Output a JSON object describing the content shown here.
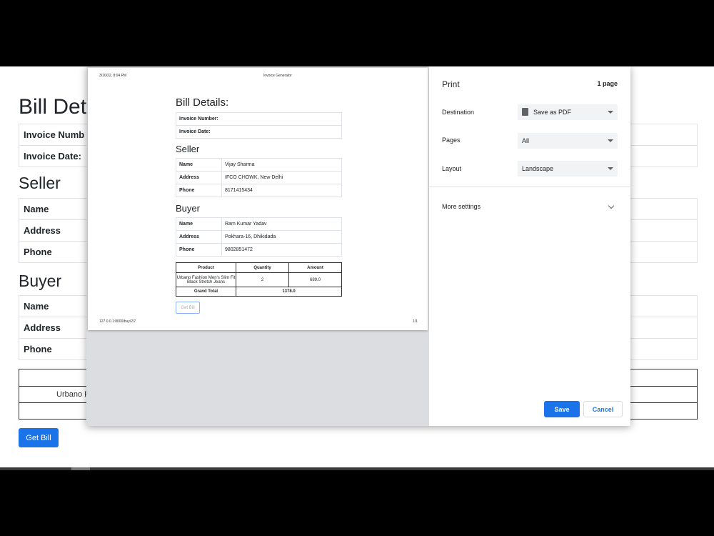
{
  "background": {
    "bill_heading": "Bill Det",
    "invoice_number_label": "Invoice Numb",
    "invoice_date_label": "Invoice Date:",
    "seller_heading": "Seller",
    "buyer_heading": "Buyer",
    "name_label": "Name",
    "address_label": "Address",
    "phone_label": "Phone",
    "product_partial": "Urbano F",
    "get_bill_button": "Get Bill"
  },
  "preview": {
    "header_date": "3/10/22, 8:04 PM",
    "header_title": "Invoice Generator",
    "footer_url": "127.0.0.1:8000/buy/2/7",
    "footer_page": "1/1",
    "bill_heading": "Bill Details:",
    "invoice_number_label": "Invoice Number:",
    "invoice_date_label": "Invoice Date:",
    "seller_heading": "Seller",
    "seller": {
      "name_label": "Name",
      "name": "Vijay Sharma",
      "address_label": "Address",
      "address": "IFCO CHOWK, New Delhi",
      "phone_label": "Phone",
      "phone": "8171415434"
    },
    "buyer_heading": "Buyer",
    "buyer": {
      "name_label": "Name",
      "name": "Ram Kumar Yadav",
      "address_label": "Address",
      "address": "Pokhara-16, Dhikidada",
      "phone_label": "Phone",
      "phone": "9802851472"
    },
    "product_table": {
      "headers": [
        "Product",
        "Quantity",
        "Amount"
      ],
      "row": {
        "product": "Urbano Fashion Men's Slim Fit Black Stretch Jeans",
        "quantity": "2",
        "amount": "689.0"
      },
      "grand_total_label": "Grand Total",
      "grand_total_value": "1378.0"
    },
    "get_bill_button": "Get Bill"
  },
  "settings": {
    "title": "Print",
    "page_count": "1 page",
    "destination_label": "Destination",
    "destination_value": "Save as PDF",
    "pages_label": "Pages",
    "pages_value": "All",
    "layout_label": "Layout",
    "layout_value": "Landscape",
    "more_settings": "More settings",
    "save_button": "Save",
    "cancel_button": "Cancel"
  }
}
